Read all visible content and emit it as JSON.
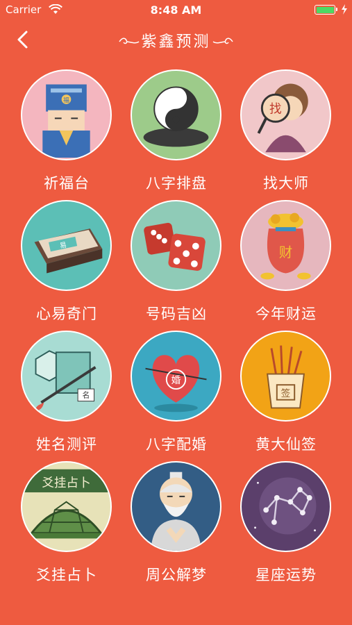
{
  "status": {
    "carrier": "Carrier",
    "time": "8:48 AM"
  },
  "nav": {
    "title": "紫鑫预测"
  },
  "items": [
    {
      "label": "祈福台",
      "bg": "#F4B6BF",
      "icon": "deity-icon"
    },
    {
      "label": "八字排盘",
      "bg": "#9DCB8A",
      "icon": "yin-yang-icon"
    },
    {
      "label": "找大师",
      "bg": "#F1C7C9",
      "icon": "magnifier-icon"
    },
    {
      "label": "心易奇门",
      "bg": "#5CBFB6",
      "icon": "book-box-icon"
    },
    {
      "label": "号码吉凶",
      "bg": "#8FCBB7",
      "icon": "dice-icon"
    },
    {
      "label": "今年财运",
      "bg": "#E6B7BE",
      "icon": "money-bag-icon"
    },
    {
      "label": "姓名测评",
      "bg": "#A8DCD3",
      "icon": "brush-scroll-icon"
    },
    {
      "label": "八字配婚",
      "bg": "#3CA8C2",
      "icon": "heart-icon"
    },
    {
      "label": "黄大仙签",
      "bg": "#F2A316",
      "icon": "fortune-sticks-icon"
    },
    {
      "label": "爻挂占卜",
      "bg": "#E7E2B8",
      "icon": "turtle-shell-icon"
    },
    {
      "label": "周公解梦",
      "bg": "#335D85",
      "icon": "sage-icon"
    },
    {
      "label": "星座运势",
      "bg": "#5B3F6B",
      "icon": "constellation-icon"
    }
  ],
  "turtle_banner": "爻挂占卜",
  "magnifier_char": "找",
  "bag_char": "财",
  "heart_char": "婚",
  "stick_char": "签",
  "box_char": "易",
  "name_char": "名",
  "deity_char": "福"
}
